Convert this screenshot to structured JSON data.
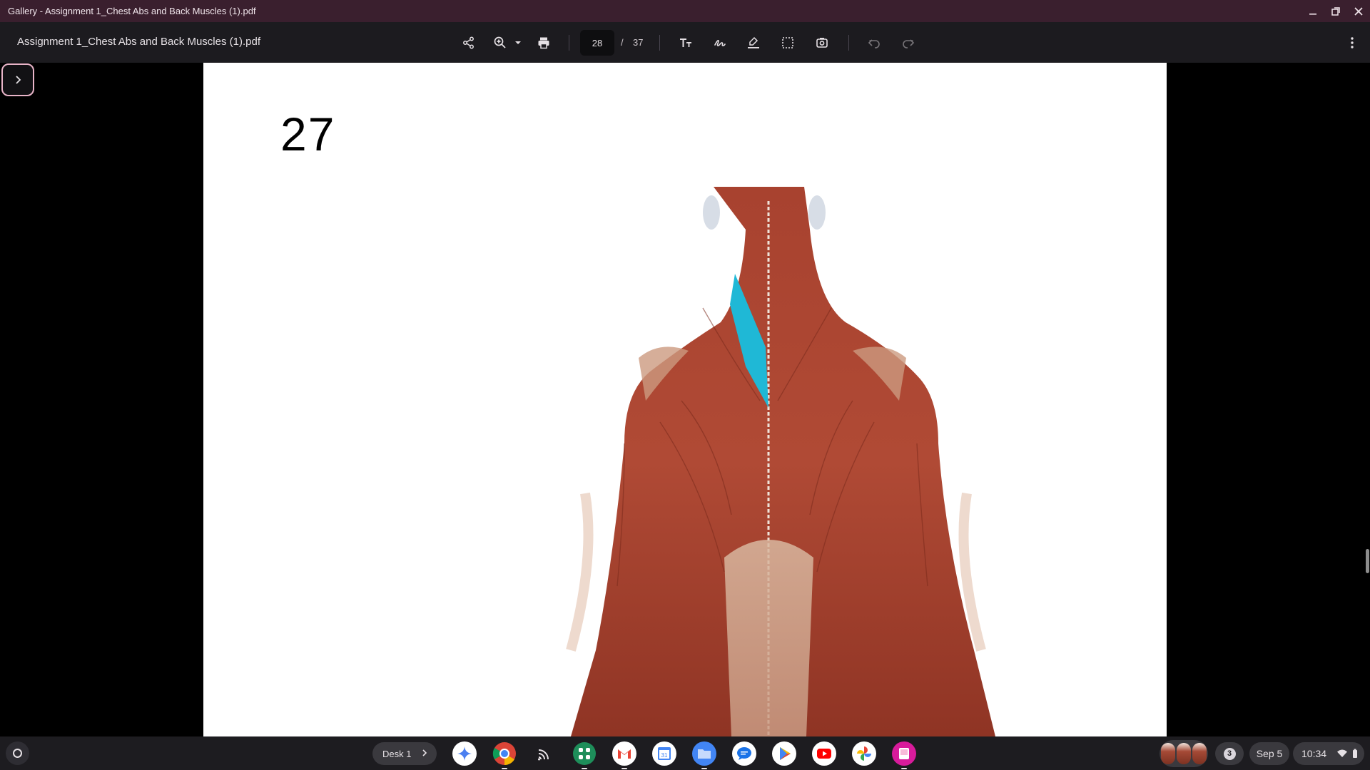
{
  "window": {
    "title": "Gallery - Assignment 1_Chest Abs and Back Muscles (1).pdf",
    "minimize_icon": "minimize-icon",
    "restore_icon": "restore-icon",
    "close_icon": "close-icon"
  },
  "toolbar": {
    "document_title": "Assignment 1_Chest Abs and Back Muscles (1).pdf",
    "current_page": "28",
    "page_separator": "/",
    "total_pages": "37",
    "icons": [
      "share-icon",
      "zoom-icon",
      "print-icon",
      "text-icon",
      "draw-icon",
      "highlighter-icon",
      "select-region-icon",
      "screenshot-icon",
      "undo-icon",
      "redo-icon",
      "more-icon"
    ]
  },
  "document": {
    "page_label": "27",
    "highlight_color": "#1fb8d6"
  },
  "shelf": {
    "desk_label": "Desk 1",
    "notification_count": "3",
    "date": "Sep 5",
    "time": "10:34",
    "apps": [
      "gemini",
      "chrome",
      "cast",
      "app-grid",
      "gmail",
      "calendar",
      "files",
      "messages",
      "play-store",
      "youtube",
      "photos",
      "gallery"
    ]
  }
}
